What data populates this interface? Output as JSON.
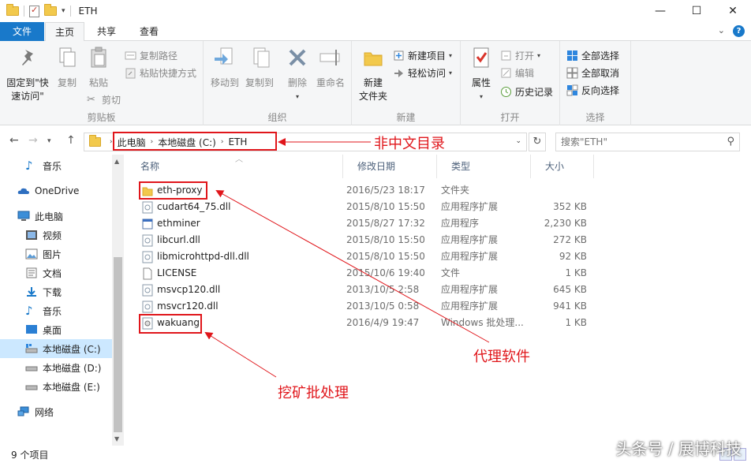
{
  "window": {
    "title": "ETH",
    "controls": {
      "minimize": "—",
      "maximize": "☐",
      "close": "✕"
    }
  },
  "ribbon_tabs": {
    "file": "文件",
    "home": "主页",
    "share": "共享",
    "view": "查看"
  },
  "ribbon": {
    "clipboard": {
      "label": "剪贴板",
      "pin": "固定到\"快\n速访问\"",
      "copy": "复制",
      "paste": "粘贴",
      "copy_path": "复制路径",
      "paste_shortcut": "粘贴快捷方式",
      "cut": "剪切"
    },
    "organize": {
      "label": "组织",
      "move_to": "移动到",
      "copy_to": "复制到",
      "delete": "删除",
      "rename": "重命名"
    },
    "new": {
      "label": "新建",
      "new_folder": "新建\n文件夹",
      "new_item": "新建项目",
      "easy_access": "轻松访问"
    },
    "open": {
      "label": "打开",
      "properties": "属性",
      "open": "打开",
      "edit": "编辑",
      "history": "历史记录"
    },
    "select": {
      "label": "选择",
      "select_all": "全部选择",
      "select_none": "全部取消",
      "invert": "反向选择"
    }
  },
  "address": {
    "crumbs": [
      "此电脑",
      "本地磁盘 (C:)",
      "ETH"
    ],
    "search_placeholder": "搜索\"ETH\""
  },
  "nav": [
    {
      "label": "音乐",
      "icon": "music-icon"
    },
    {
      "label": "OneDrive",
      "icon": "cloud-icon"
    },
    {
      "label": "此电脑",
      "icon": "computer-icon"
    },
    {
      "label": "视频",
      "icon": "video-icon"
    },
    {
      "label": "图片",
      "icon": "picture-icon"
    },
    {
      "label": "文档",
      "icon": "document-icon"
    },
    {
      "label": "下载",
      "icon": "download-icon"
    },
    {
      "label": "音乐",
      "icon": "music-icon"
    },
    {
      "label": "桌面",
      "icon": "desktop-icon"
    },
    {
      "label": "本地磁盘 (C:)",
      "icon": "drive-icon",
      "selected": true
    },
    {
      "label": "本地磁盘 (D:)",
      "icon": "drive-icon"
    },
    {
      "label": "本地磁盘 (E:)",
      "icon": "drive-icon"
    },
    {
      "label": "网络",
      "icon": "network-icon"
    }
  ],
  "columns": {
    "name": "名称",
    "date": "修改日期",
    "type": "类型",
    "size": "大小"
  },
  "files": [
    {
      "name": "eth-proxy",
      "date": "2016/5/23 18:17",
      "type": "文件夹",
      "size": "",
      "icon": "folder-icon"
    },
    {
      "name": "cudart64_75.dll",
      "date": "2015/8/10 15:50",
      "type": "应用程序扩展",
      "size": "352 KB",
      "icon": "dll-icon"
    },
    {
      "name": "ethminer",
      "date": "2015/8/27 17:32",
      "type": "应用程序",
      "size": "2,230 KB",
      "icon": "exe-icon"
    },
    {
      "name": "libcurl.dll",
      "date": "2015/8/10 15:50",
      "type": "应用程序扩展",
      "size": "272 KB",
      "icon": "dll-icon"
    },
    {
      "name": "libmicrohttpd-dll.dll",
      "date": "2015/8/10 15:50",
      "type": "应用程序扩展",
      "size": "92 KB",
      "icon": "dll-icon"
    },
    {
      "name": "LICENSE",
      "date": "2015/10/6 19:40",
      "type": "文件",
      "size": "1 KB",
      "icon": "file-icon"
    },
    {
      "name": "msvcp120.dll",
      "date": "2013/10/5 2:58",
      "type": "应用程序扩展",
      "size": "645 KB",
      "icon": "dll-icon"
    },
    {
      "name": "msvcr120.dll",
      "date": "2013/10/5 0:58",
      "type": "应用程序扩展",
      "size": "941 KB",
      "icon": "dll-icon"
    },
    {
      "name": "wakuang",
      "date": "2016/4/9 19:47",
      "type": "Windows 批处理...",
      "size": "1 KB",
      "icon": "batch-icon"
    }
  ],
  "annotations": {
    "address": "非中文目录",
    "proxy": "代理软件",
    "batch": "挖矿批处理"
  },
  "status": "9 个项目",
  "watermark": "头条号 / 展博科技",
  "colors": {
    "accent": "#1979ca",
    "annotation": "#e0161b",
    "selection": "#cce8ff",
    "folder": "#f2c94c"
  }
}
